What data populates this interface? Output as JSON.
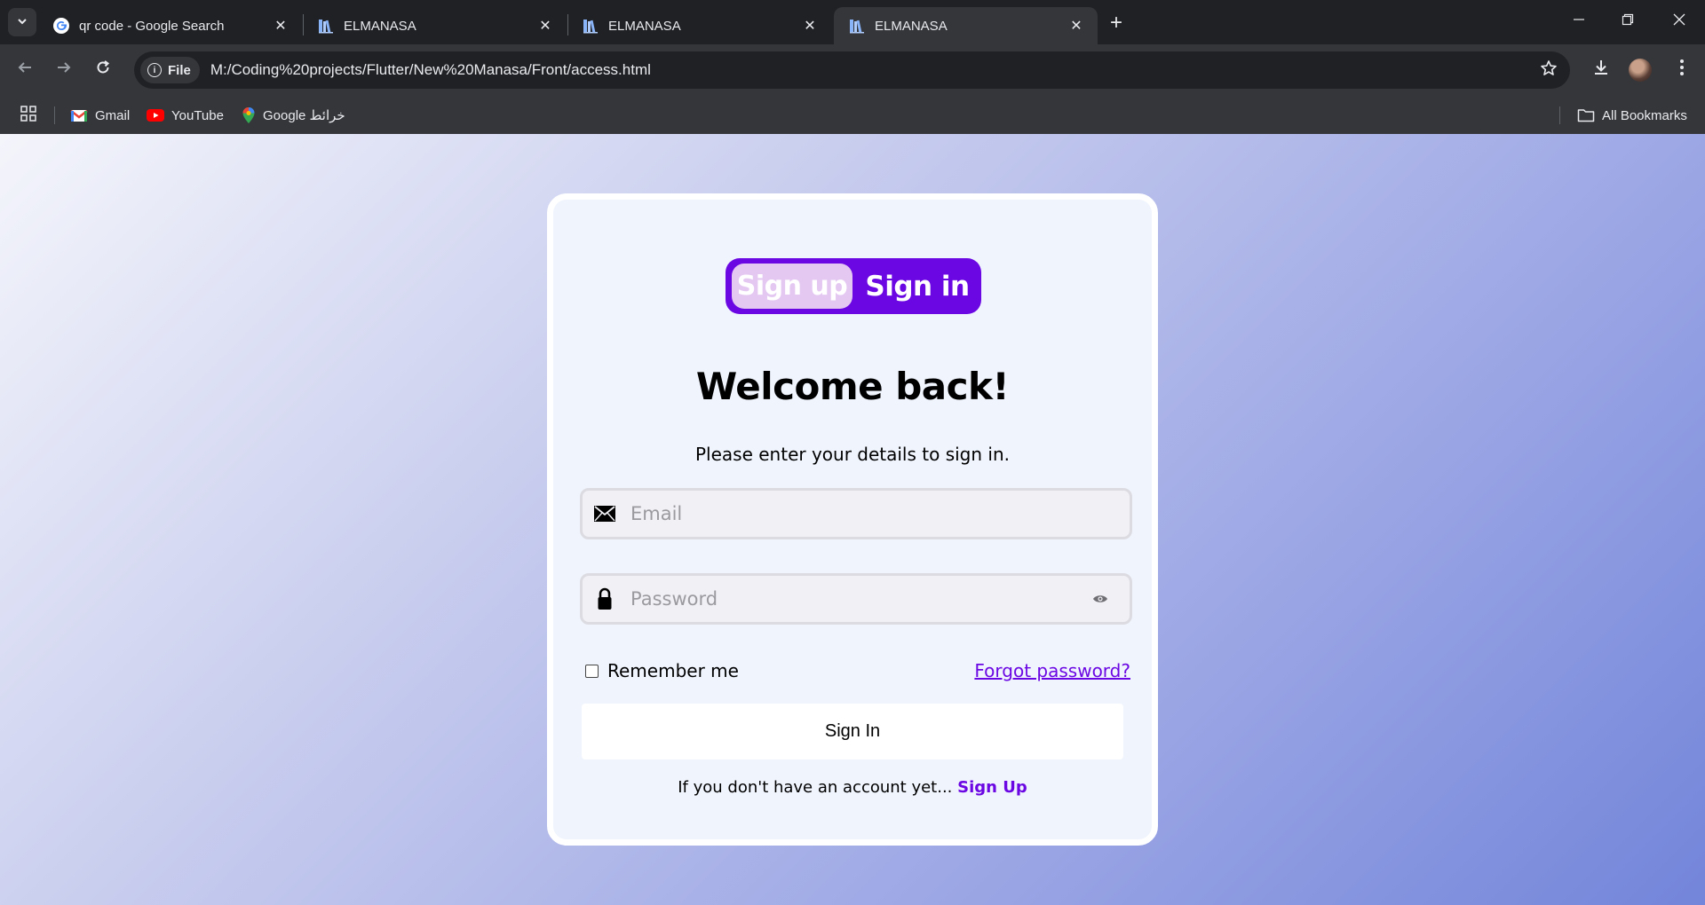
{
  "browser": {
    "tabs": [
      {
        "title": "qr code - Google Search",
        "favicon": "google-g-icon",
        "active": false
      },
      {
        "title": "ELMANASA",
        "favicon": "books-icon",
        "active": false
      },
      {
        "title": "ELMANASA",
        "favicon": "books-icon",
        "active": false
      },
      {
        "title": "ELMANASA",
        "favicon": "books-icon",
        "active": true
      }
    ],
    "address": {
      "chip_label": "File",
      "url": "M:/Coding%20projects/Flutter/New%20Manasa/Front/access.html"
    },
    "bookmarks": [
      {
        "label": "Gmail",
        "icon": "gmail-icon"
      },
      {
        "label": "YouTube",
        "icon": "youtube-icon"
      },
      {
        "label": "Google خرائط",
        "icon": "maps-pin-icon"
      }
    ],
    "all_bookmarks_label": "All Bookmarks"
  },
  "auth": {
    "toggle": {
      "signup_label": "Sign up",
      "signin_label": "Sign in",
      "active": "signin"
    },
    "heading": "Welcome back!",
    "subtitle": "Please enter your details to sign in.",
    "email_placeholder": "Email",
    "password_placeholder": "Password",
    "remember_label": "Remember me",
    "remember_checked": false,
    "forgot_label": "Forgot password?",
    "submit_label": "Sign In",
    "footer_text": "If you don't have an account yet...",
    "footer_link": "Sign Up"
  },
  "colors": {
    "accent": "#6b07e3",
    "toggle_inactive": "#e4c8f2",
    "card_bg": "#f0f4fd",
    "gradient_start": "#f4f5fb",
    "gradient_end": "#7385da"
  }
}
